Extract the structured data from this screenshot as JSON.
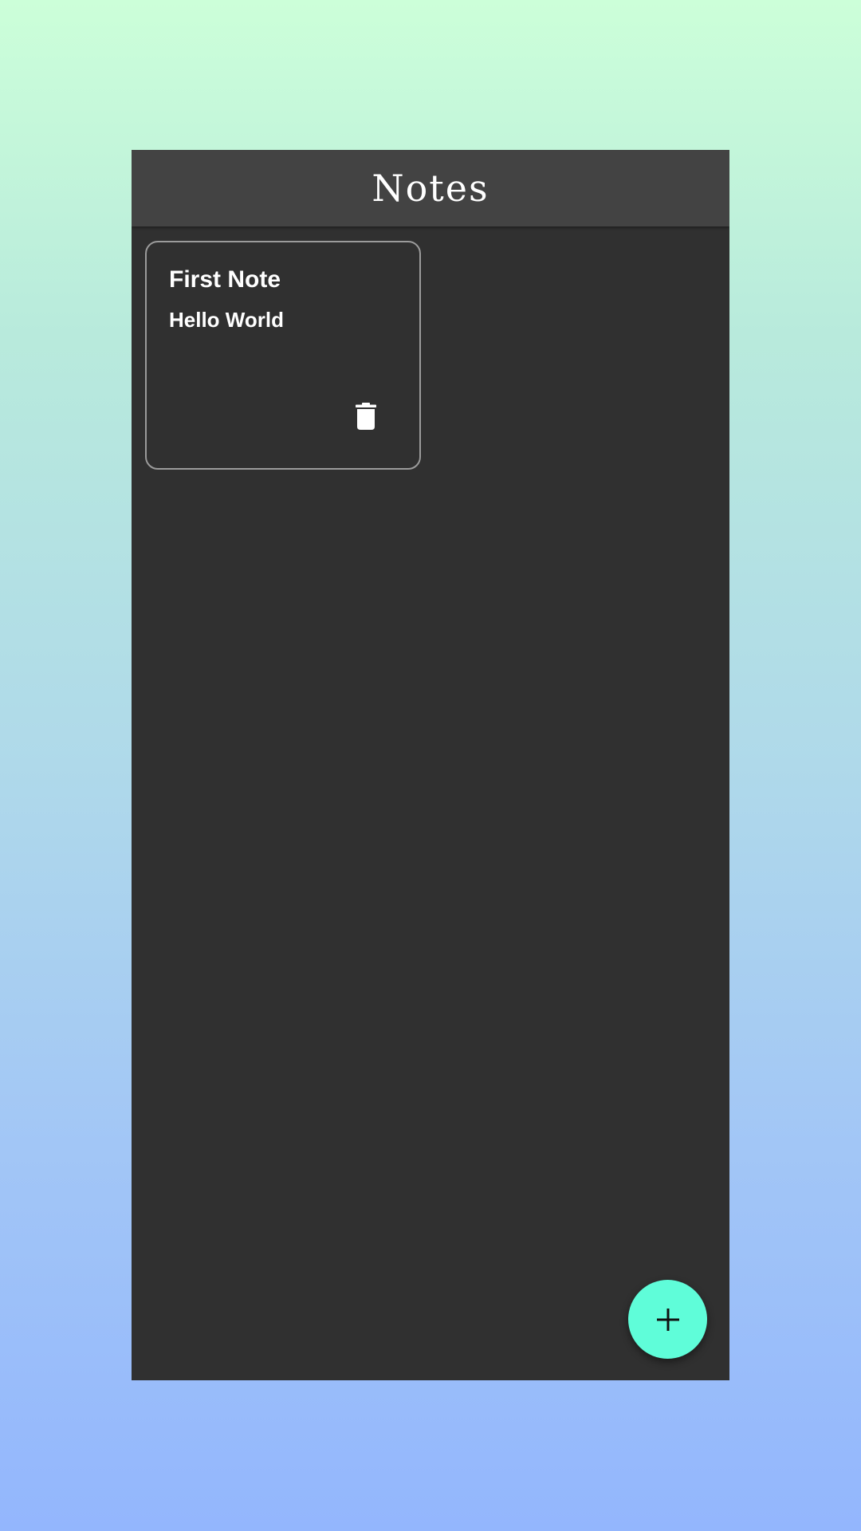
{
  "header": {
    "title": "Notes"
  },
  "notes": [
    {
      "title": "First Note",
      "body": "Hello World",
      "delete_icon": "trash-icon"
    }
  ],
  "fab": {
    "icon": "plus-icon"
  },
  "colors": {
    "background_top": "#ccffd9",
    "background_bottom": "#93b6fd",
    "app_background": "#303030",
    "header_background": "#434343",
    "card_border": "#9b9b9b",
    "accent": "#5ffdd9",
    "text": "#ffffff"
  }
}
